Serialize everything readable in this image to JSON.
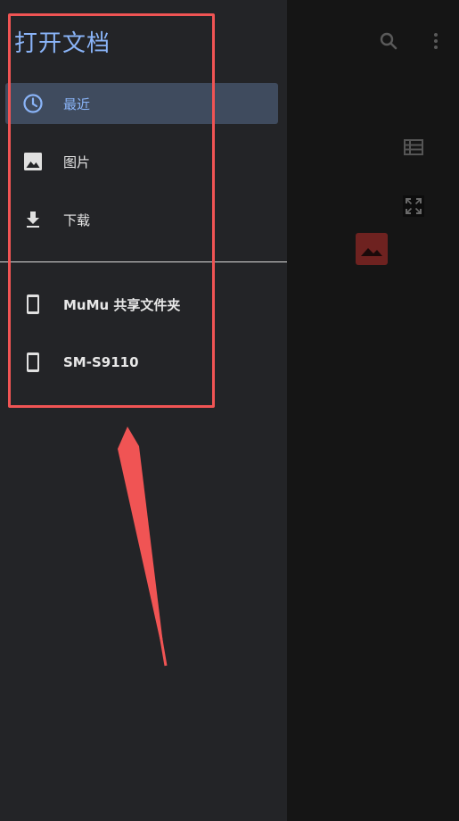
{
  "drawer": {
    "title": "打开文档",
    "items": [
      {
        "label": "最近",
        "icon": "clock-icon",
        "selected": true
      },
      {
        "label": "图片",
        "icon": "image-icon",
        "selected": false
      },
      {
        "label": "下载",
        "icon": "download-icon",
        "selected": false
      }
    ],
    "devices": [
      {
        "label": "MuMu 共享文件夹",
        "icon": "phone-icon"
      },
      {
        "label": "SM-S9110",
        "icon": "phone-icon"
      }
    ]
  },
  "background_app": {
    "icons": [
      "search-icon",
      "more-vert-icon",
      "list-view-icon",
      "fullscreen-icon",
      "image-thumbnail-icon"
    ]
  },
  "annotation": {
    "box_color": "#f05454",
    "arrow_color": "#f05454"
  },
  "colors": {
    "accent": "#8ab4f8",
    "selected_bg": "#3f4b5e",
    "drawer_bg": "#232427"
  }
}
